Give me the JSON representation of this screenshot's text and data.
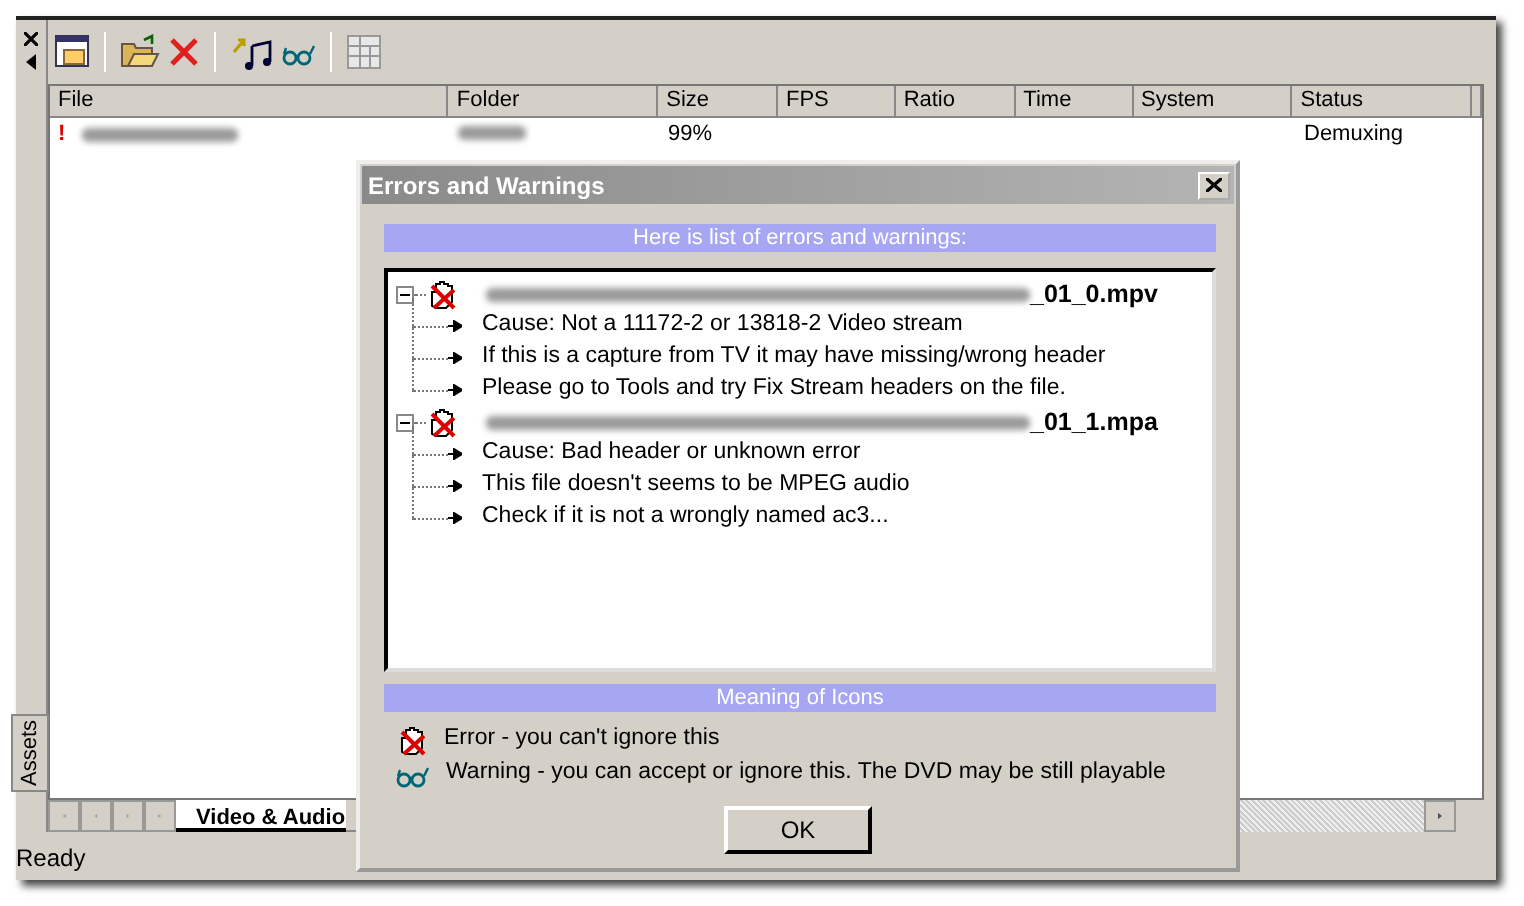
{
  "side_panel": {
    "label": "Assets"
  },
  "table": {
    "columns": [
      "File",
      "Folder",
      "Size",
      "FPS",
      "Ratio",
      "Time",
      "System",
      "Status"
    ],
    "rows": [
      {
        "flag": "!",
        "size": "99%",
        "status": "Demuxing"
      }
    ]
  },
  "tabs": [
    {
      "label": "Video & Audio",
      "selected": true
    }
  ],
  "status_bar": "Ready",
  "dialog": {
    "title": "Errors and Warnings",
    "list_header": "Here is list of errors and warnings:",
    "items": [
      {
        "kind": "error",
        "expanded": true,
        "name_suffix": "_01_0.mpv",
        "children": [
          {
            "text": "Cause: Not a 11172-2 or 13818-2 Video stream"
          },
          {
            "text": "If this is a capture from TV it may have missing/wrong header"
          },
          {
            "text": "Please go to Tools and try Fix Stream headers on the file."
          }
        ]
      },
      {
        "kind": "error",
        "expanded": true,
        "name_suffix": "_01_1.mpa",
        "children": [
          {
            "text": "Cause: Bad header or unknown error"
          },
          {
            "text": "This file doesn't seems to be MPEG audio"
          },
          {
            "text": "Check if it is not a wrongly named ac3..."
          }
        ]
      }
    ],
    "legend_header": "Meaning of Icons",
    "legend": [
      {
        "kind": "error",
        "text": "Error - you can't ignore this"
      },
      {
        "kind": "warning",
        "text": "Warning - you can accept or ignore this. The DVD may be still playable"
      }
    ],
    "button": "OK"
  }
}
